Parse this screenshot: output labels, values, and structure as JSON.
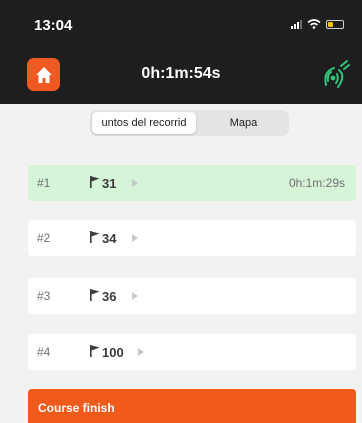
{
  "status_bar": {
    "time": "13:04"
  },
  "header": {
    "title": "0h:1m:54s"
  },
  "tabs": [
    {
      "label": "untos del recorrid"
    },
    {
      "label": "Mapa"
    }
  ],
  "rows": [
    {
      "index": "#1",
      "number": "31",
      "time": "0h:1m:29s"
    },
    {
      "index": "#2",
      "number": "34"
    },
    {
      "index": "#3",
      "number": "36"
    },
    {
      "index": "#4",
      "number": "100"
    }
  ],
  "finish": {
    "label": "Course finish"
  },
  "colors": {
    "accent": "#f05a22",
    "header_bg": "#1e1e1e",
    "active_row": "#d5f4d8",
    "gps_green": "#34c37a"
  },
  "icons": [
    "home-icon",
    "gps-signal-icon",
    "flag-icon",
    "play-icon",
    "signal-bars-icon",
    "wifi-icon",
    "battery-icon"
  ]
}
